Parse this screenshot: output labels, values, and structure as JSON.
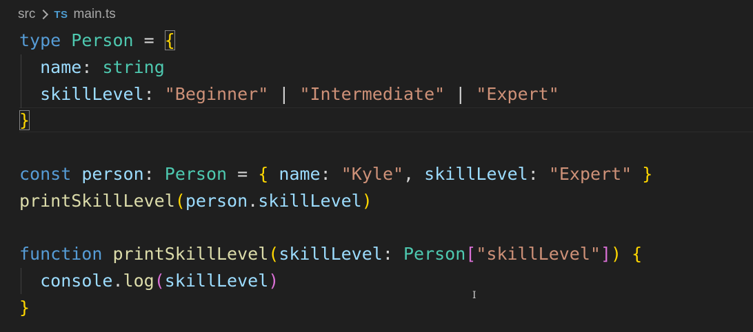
{
  "breadcrumb": {
    "folder": "src",
    "file_icon": "TS",
    "file": "main.ts"
  },
  "code": {
    "l1": {
      "kw": "type",
      "name": "Person",
      "eq": "=",
      "brace": "{"
    },
    "l2": {
      "prop": "name",
      "colon": ":",
      "type": "string"
    },
    "l3": {
      "prop": "skillLevel",
      "colon": ":",
      "s1": "\"Beginner\"",
      "bar1": "|",
      "s2": "\"Intermediate\"",
      "bar2": "|",
      "s3": "\"Expert\""
    },
    "l4": {
      "brace": "}"
    },
    "l6": {
      "kw": "const",
      "var": "person",
      "colon": ":",
      "type": "Person",
      "eq": "=",
      "open": "{",
      "p1": "name",
      "c1": ":",
      "v1": "\"Kyle\"",
      "comma": ",",
      "p2": "skillLevel",
      "c2": ":",
      "v2": "\"Expert\"",
      "close": "}"
    },
    "l7": {
      "fn": "printSkillLevel",
      "open": "(",
      "obj": "person",
      "dot": ".",
      "prop": "skillLevel",
      "close": ")"
    },
    "l9": {
      "kw": "function",
      "fn": "printSkillLevel",
      "open": "(",
      "param": "skillLevel",
      "colon": ":",
      "type": "Person",
      "lb": "[",
      "key": "\"skillLevel\"",
      "rb": "]",
      "close": ")",
      "brace": "{"
    },
    "l10": {
      "obj": "console",
      "dot": ".",
      "fn": "log",
      "open": "(",
      "arg": "skillLevel",
      "close": ")"
    },
    "l11": {
      "brace": "}"
    }
  },
  "colors": {
    "background": "#1f1f1f",
    "keyword": "#569cd6",
    "type": "#4ec9b0",
    "property": "#9cdcfe",
    "function": "#dcdcaa",
    "string": "#ce9178",
    "bracket_level1": "#ffd700",
    "bracket_level2": "#da70d6",
    "bracket_level3": "#179fff"
  },
  "mouse_cursor": "text-cursor-icon"
}
